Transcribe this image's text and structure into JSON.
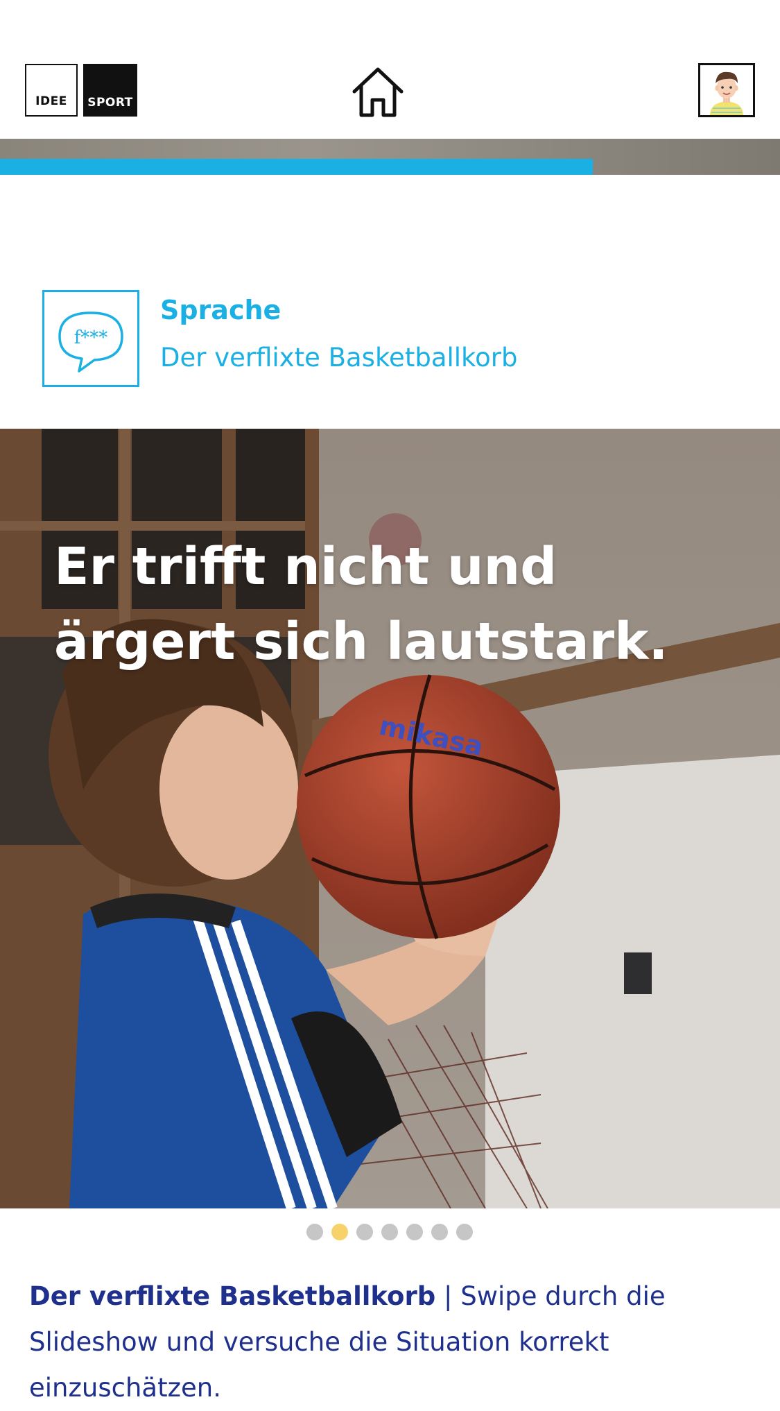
{
  "header": {
    "logo": {
      "word1": "IDEE",
      "word2": "SPORT"
    },
    "home_icon": "home-icon",
    "avatar_icon": "user-avatar-icon"
  },
  "progress": {
    "value_percent": 76,
    "fill_color": "#1bb0e4"
  },
  "category": {
    "icon": "speech-bubble-icon",
    "icon_text": "f***",
    "title": "Sprache",
    "subtitle": "Der verflixte Basketballkorb",
    "accent": "#1bb0e4"
  },
  "slide": {
    "heading": "Er trifft nicht und ärgert sich lautstark."
  },
  "pagination": {
    "total": 7,
    "active_index": 1
  },
  "caption": {
    "bold": "Der verflixte Basketballkorb",
    "separator": " | ",
    "text": "Swipe durch die Slideshow und versuche die Situation korrekt einzuschätzen.",
    "color": "#1f2f8c"
  }
}
